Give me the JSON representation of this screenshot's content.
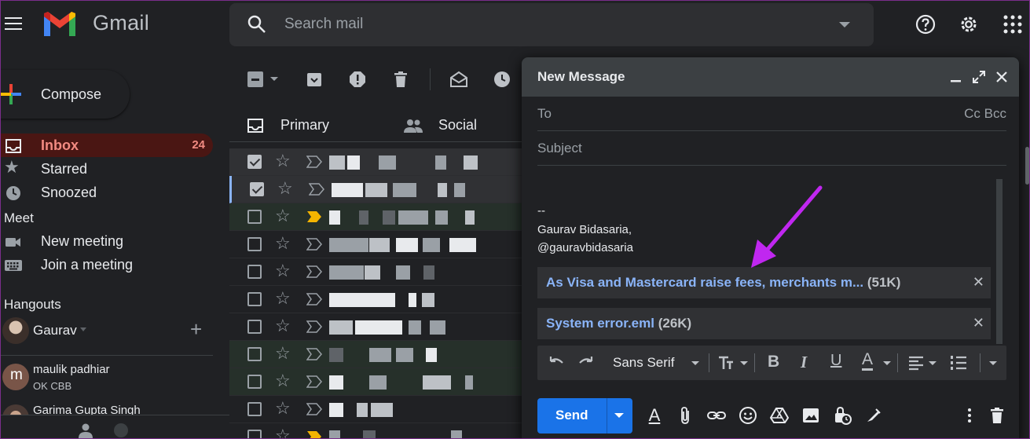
{
  "app": {
    "name": "Gmail"
  },
  "search": {
    "placeholder": "Search mail"
  },
  "compose_button": {
    "label": "Compose"
  },
  "nav": [
    {
      "label": "Inbox",
      "count": "24",
      "icon": "inbox-icon"
    },
    {
      "label": "Starred",
      "icon": "star-icon"
    },
    {
      "label": "Snoozed",
      "icon": "clock-icon"
    }
  ],
  "meet": {
    "title": "Meet",
    "items": [
      {
        "label": "New meeting",
        "icon": "video-icon"
      },
      {
        "label": "Join a meeting",
        "icon": "keyboard-icon"
      }
    ]
  },
  "hangouts": {
    "title": "Hangouts",
    "me": "Gaurav",
    "contacts": [
      {
        "initial": "m",
        "name": "maulik padhiar",
        "status": "OK CBB"
      },
      {
        "name": "Garima Gupta Singh"
      }
    ]
  },
  "tabs": [
    {
      "label": "Primary",
      "icon": "inbox-tab-icon"
    },
    {
      "label": "Social",
      "icon": "people-icon"
    }
  ],
  "mail_rows": [
    {
      "checked": true,
      "important": false
    },
    {
      "checked": true,
      "important": false
    },
    {
      "checked": false,
      "important": true
    },
    {
      "checked": false,
      "important": false
    },
    {
      "checked": false,
      "important": false
    },
    {
      "checked": false,
      "important": false
    },
    {
      "checked": false,
      "important": false
    },
    {
      "checked": false,
      "important": false
    },
    {
      "checked": false,
      "important": false
    },
    {
      "checked": false,
      "important": false
    },
    {
      "checked": false,
      "important": true
    }
  ],
  "compose": {
    "title": "New Message",
    "to_label": "To",
    "cc_bcc": "Cc Bcc",
    "subject_placeholder": "Subject",
    "signature": {
      "dashes": "--",
      "name": "Gaurav Bidasaria,",
      "handle": "@gauravbidasaria"
    },
    "attachments": [
      {
        "name": "As Visa and Mastercard raise fees, merchants m...",
        "size": "(51K)"
      },
      {
        "name": "System error.eml",
        "size": "(26K)"
      }
    ],
    "font": "Sans Serif",
    "send_label": "Send"
  },
  "colors": {
    "background": "#202124",
    "accent_red": "#f28b82",
    "link_blue": "#8ab4f8",
    "send_blue": "#1a73e8",
    "arrow": "#c027f0"
  }
}
